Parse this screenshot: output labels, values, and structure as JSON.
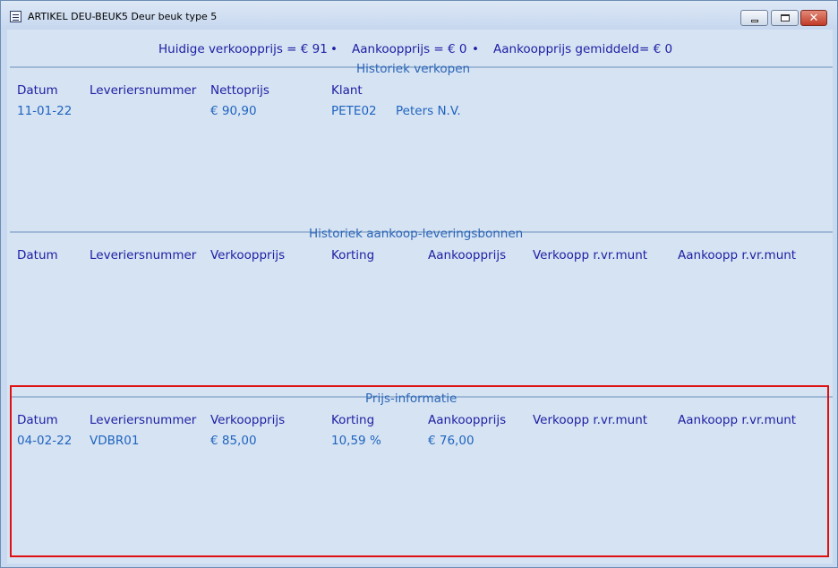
{
  "window": {
    "title": "ARTIKEL DEU-BEUK5 Deur beuk type 5",
    "icon": "app-document-icon",
    "controls": [
      "minimize-icon",
      "maximize-icon",
      "close-icon"
    ],
    "close_color": "#c13b27"
  },
  "summary": {
    "current_price": "Huidige verkoopprijs = € 91",
    "bullet": "•",
    "purchase_price": "Aankoopprijs = € 0",
    "avg_purchase_price": "Aankoopprijs gemiddeld= € 0"
  },
  "sales_history": {
    "title": "Historiek verkopen",
    "columns": [
      "Datum",
      "Leveriersnummer",
      "Nettoprijs",
      "Klant"
    ],
    "rows": [
      {
        "datum": "11-01-22",
        "leveriersnummer": "",
        "nettoprijs": "€ 90,90",
        "klant_code": "PETE02",
        "klant_naam": "Peters N.V."
      }
    ]
  },
  "purchase_history": {
    "title": "Historiek aankoop-leveringsbonnen",
    "columns": [
      "Datum",
      "Leveriersnummer",
      "Verkoopprijs",
      "Korting",
      "Aankoopprijs",
      "Verkoopp r.vr.munt",
      "Aankoopp r.vr.munt"
    ],
    "rows": []
  },
  "price_info": {
    "title": "Prijs-informatie",
    "columns": [
      "Datum",
      "Leveriersnummer",
      "Verkoopprijs",
      "Korting",
      "Aankoopprijs",
      "Verkoopp r.vr.munt",
      "Aankoopp r.vr.munt"
    ],
    "rows": [
      {
        "datum": "04-02-22",
        "leveriersnummer": "VDBR01",
        "verkoopprijs": "€ 85,00",
        "korting": "10,59 %",
        "aankoopprijs": "€ 76,00"
      }
    ],
    "highlight_color": "#e01010"
  }
}
